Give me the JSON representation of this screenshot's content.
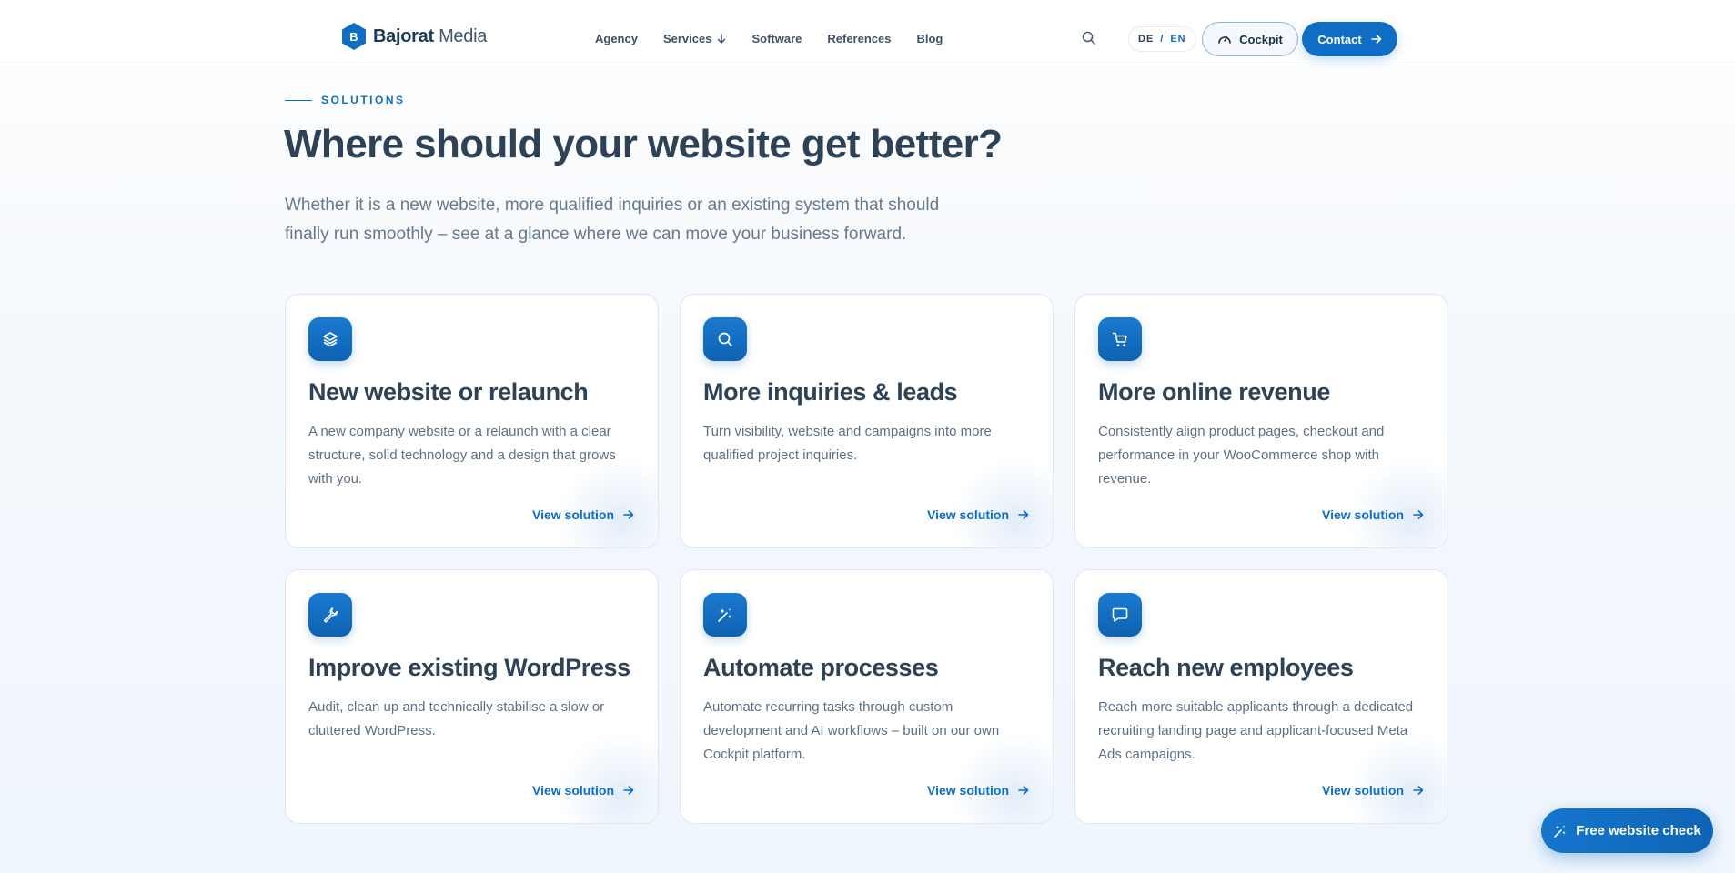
{
  "header": {
    "logo": {
      "brand_bold": "Bajorat",
      "brand_rest": " Media"
    },
    "nav": [
      {
        "label": "Agency"
      },
      {
        "label": "Services"
      },
      {
        "label": "Software"
      },
      {
        "label": "References"
      },
      {
        "label": "Blog"
      }
    ],
    "lang": {
      "de": "DE",
      "sep": "/",
      "en": "EN"
    },
    "cockpit_label": "Cockpit",
    "contact_label": "Contact"
  },
  "intro": {
    "eyebrow": "SOLUTIONS",
    "title": "Where should your website get better?",
    "lead": "Whether it is a new website, more qualified inquiries or an existing system that should finally run smoothly – see at a glance where we can move your business forward."
  },
  "cards": [
    {
      "icon": "layers-icon",
      "title": "New website or relaunch",
      "desc": "A new company website or a relaunch with a clear structure, solid technology and a design that grows with you.",
      "link": "View solution"
    },
    {
      "icon": "search-icon",
      "title": "More inquiries & leads",
      "desc": "Turn visibility, website and campaigns into more qualified project inquiries.",
      "link": "View solution"
    },
    {
      "icon": "cart-icon",
      "title": "More online revenue",
      "desc": "Consistently align product pages, checkout and performance in your WooCommerce shop with revenue.",
      "link": "View solution"
    },
    {
      "icon": "wrench-icon",
      "title": "Improve existing WordPress",
      "desc": "Audit, clean up and technically stabilise a slow or cluttered WordPress.",
      "link": "View solution"
    },
    {
      "icon": "sparkles-icon",
      "title": "Automate processes",
      "desc": "Automate recurring tasks through custom development and AI workflows – built on our own Cockpit platform.",
      "link": "View solution"
    },
    {
      "icon": "chat-icon",
      "title": "Reach new employees",
      "desc": "Reach more suitable applicants through a dedicated recruiting landing page and applicant-focused Meta Ads campaigns.",
      "link": "View solution"
    }
  ],
  "cta_label": "Free website check",
  "colors": {
    "accent": "#0f6dc4",
    "heading": "#2d4256",
    "body": "#5e7083"
  }
}
